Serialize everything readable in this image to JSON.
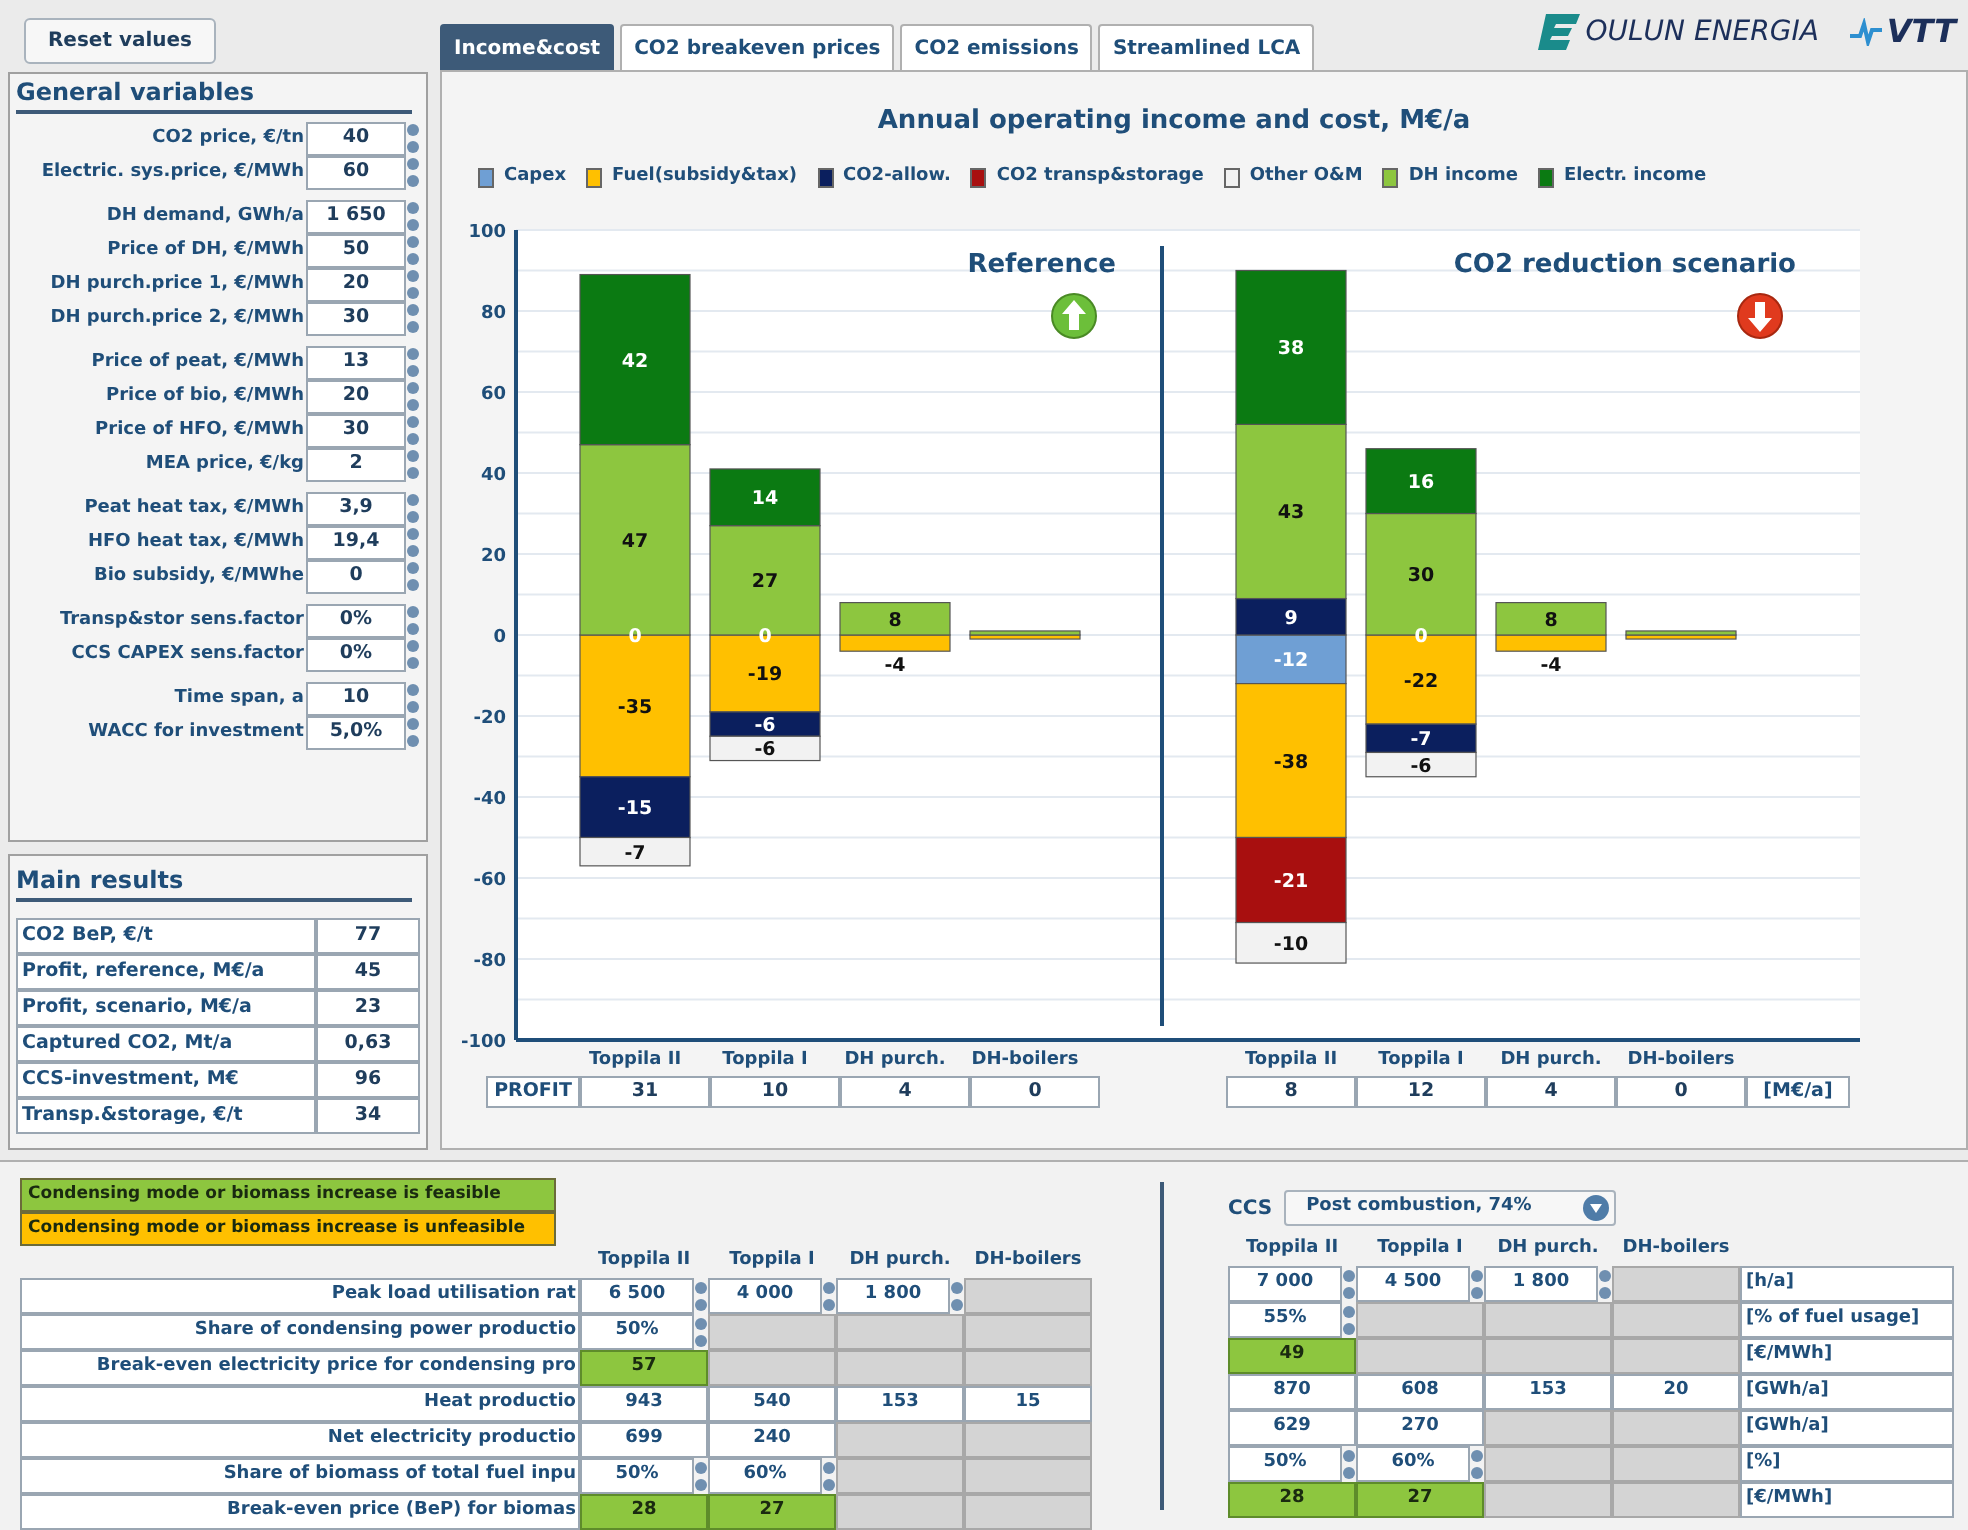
{
  "reset_button": "Reset values",
  "general_variables": {
    "title": "General variables",
    "groups": [
      [
        {
          "label": "CO2 price, €/tn",
          "value": "40"
        },
        {
          "label": "Electric. sys.price, €/MWh",
          "value": "60"
        }
      ],
      [
        {
          "label": "DH demand, GWh/a",
          "value": "1 650"
        },
        {
          "label": "Price of DH, €/MWh",
          "value": "50"
        },
        {
          "label": "DH purch.price 1, €/MWh",
          "value": "20"
        },
        {
          "label": "DH purch.price 2, €/MWh",
          "value": "30"
        }
      ],
      [
        {
          "label": "Price of peat, €/MWh",
          "value": "13"
        },
        {
          "label": "Price of bio, €/MWh",
          "value": "20"
        },
        {
          "label": "Price of HFO, €/MWh",
          "value": "30"
        },
        {
          "label": "MEA price, €/kg",
          "value": "2"
        }
      ],
      [
        {
          "label": "Peat heat tax, €/MWh",
          "value": "3,9"
        },
        {
          "label": "HFO heat tax, €/MWh",
          "value": "19,4"
        },
        {
          "label": "Bio subsidy, €/MWhe",
          "value": "0"
        }
      ],
      [
        {
          "label": "Transp&stor sens.factor",
          "value": "0%"
        },
        {
          "label": "CCS CAPEX sens.factor",
          "value": "0%"
        }
      ],
      [
        {
          "label": "Time span, a",
          "value": "10"
        },
        {
          "label": "WACC for investment",
          "value": "5,0%"
        }
      ]
    ]
  },
  "main_results": {
    "title": "Main results",
    "rows": [
      {
        "label": "CO2 BeP, €/t",
        "value": "77"
      },
      {
        "label": "Profit, reference, M€/a",
        "value": "45"
      },
      {
        "label": "Profit, scenario, M€/a",
        "value": "23"
      },
      {
        "label": "Captured CO2, Mt/a",
        "value": "0,63"
      },
      {
        "label": "CCS-investment, M€",
        "value": "96"
      },
      {
        "label": "Transp.&storage, €/t",
        "value": "34"
      }
    ]
  },
  "tabs": [
    {
      "label": "Income&cost",
      "selected": true
    },
    {
      "label": "CO2 breakeven prices",
      "selected": false
    },
    {
      "label": "CO2 emissions",
      "selected": false
    },
    {
      "label": "Streamlined LCA",
      "selected": false
    }
  ],
  "logos": [
    "OULUN ENERGIA",
    "VTT"
  ],
  "chart_title": "Annual operating income and cost, M€/a",
  "panels": [
    {
      "profit_increase": true,
      "profit_label": "PROFIT",
      "profits": [
        "31",
        "10",
        "4",
        "0"
      ],
      "chart_data": {
        "type": "bar",
        "stacked": true,
        "grid": true,
        "title": "Reference",
        "categories": [
          "Toppila II",
          "Toppila I",
          "DH purch.",
          "DH-boilers"
        ],
        "ylim": [
          -100,
          100
        ],
        "yticks": [
          -100,
          -80,
          -60,
          -40,
          -20,
          0,
          20,
          40,
          60,
          80,
          100
        ],
        "series": [
          {
            "name": "Capex",
            "color": "#6f9fd4",
            "values": [
              0,
              0,
              0,
              0
            ],
            "value_labels": [
              "0",
              "0",
              null,
              null
            ]
          },
          {
            "name": "Fuel(subsidy&tax)",
            "color": "#ffc000",
            "values": [
              -35,
              -19,
              -4,
              -1
            ],
            "value_labels": [
              "-35",
              "-19",
              "-4",
              null
            ]
          },
          {
            "name": "CO2-allow.",
            "color": "#0b1f5e",
            "values": [
              -15,
              -6,
              null,
              null
            ],
            "value_labels": [
              "-15",
              "-6",
              null,
              null
            ]
          },
          {
            "name": "CO2 transp&storage",
            "color": "#a80f0f",
            "values": [
              null,
              null,
              null,
              null
            ],
            "value_labels": [
              null,
              null,
              null,
              null
            ]
          },
          {
            "name": "Other O&M",
            "color": "#f2f2f2",
            "values": [
              -7,
              -6,
              null,
              null
            ],
            "value_labels": [
              "-7",
              "-6",
              null,
              null
            ]
          },
          {
            "name": "DH income",
            "color": "#8dc63f",
            "values": [
              47,
              27,
              8,
              1
            ],
            "value_labels": [
              "47",
              "27",
              "8",
              null
            ]
          },
          {
            "name": "Electr. income",
            "color": "#0b7a12",
            "values": [
              42,
              14,
              null,
              null
            ],
            "value_labels": [
              "42",
              "14",
              null,
              null
            ]
          }
        ]
      }
    },
    {
      "profit_increase": false,
      "profit_unit": "[M€/a]",
      "profits": [
        "8",
        "12",
        "4",
        "0"
      ],
      "chart_data": {
        "type": "bar",
        "stacked": true,
        "grid": true,
        "title": "CO2 reduction scenario",
        "categories": [
          "Toppila II",
          "Toppila I",
          "DH purch.",
          "DH-boilers"
        ],
        "ylim": [
          -100,
          100
        ],
        "series": [
          {
            "color": "#6f9fd4",
            "values": [
              -12,
              0,
              0,
              0
            ],
            "value_labels": [
              "-12",
              "0",
              null,
              null
            ]
          },
          {
            "color": "#ffc000",
            "values": [
              -38,
              -22,
              -4,
              -1
            ],
            "value_labels": [
              "-38",
              "-22",
              "-4",
              null
            ]
          },
          {
            "color": "#0b1f5e",
            "values": [
              9,
              -7,
              null,
              null
            ],
            "value_labels": [
              "9",
              "-7",
              null,
              null
            ]
          },
          {
            "color": "#a80f0f",
            "values": [
              -21,
              null,
              null,
              null
            ],
            "value_labels": [
              "-21",
              null,
              null,
              null
            ]
          },
          {
            "color": "#f2f2f2",
            "values": [
              -10,
              -6,
              null,
              null
            ],
            "value_labels": [
              "-10",
              "-6",
              null,
              null
            ]
          },
          {
            "color": "#8dc63f",
            "values": [
              43,
              30,
              8,
              1
            ],
            "value_labels": [
              "43",
              "30",
              "8",
              null
            ]
          },
          {
            "color": "#0b7a12",
            "values": [
              38,
              16,
              null,
              null
            ],
            "value_labels": [
              "38",
              "16",
              null,
              null
            ]
          }
        ]
      }
    }
  ],
  "feasibility_legend": [
    {
      "label": "Condensing mode or biomass increase is feasible",
      "color": "#8dc63f"
    },
    {
      "label": "Condensing mode or biomass increase is unfeasible",
      "color": "#ffc000"
    }
  ],
  "reference_table": {
    "columns": [
      "Toppila II",
      "Toppila I",
      "DH purch.",
      "DH-boilers"
    ],
    "rows": [
      {
        "label": "Peak load utilisation rat",
        "cells": [
          {
            "kind": "spin",
            "value": "6 500"
          },
          {
            "kind": "spin",
            "value": "4 000"
          },
          {
            "kind": "spin",
            "value": "1 800"
          },
          {
            "kind": "blank"
          }
        ]
      },
      {
        "label": "Share of condensing power productio",
        "cells": [
          {
            "kind": "spin",
            "value": "50%"
          },
          {
            "kind": "blank"
          },
          {
            "kind": "blank"
          },
          {
            "kind": "blank"
          }
        ]
      },
      {
        "label": "Break-even electricity price for condensing pro",
        "cells": [
          {
            "kind": "feasible",
            "value": "57"
          },
          {
            "kind": "blank"
          },
          {
            "kind": "blank"
          },
          {
            "kind": "blank"
          }
        ]
      },
      {
        "label": "Heat productio",
        "cells": [
          {
            "kind": "plain",
            "value": "943"
          },
          {
            "kind": "plain",
            "value": "540"
          },
          {
            "kind": "plain",
            "value": "153"
          },
          {
            "kind": "plain",
            "value": "15"
          }
        ]
      },
      {
        "label": "Net electricity productio",
        "cells": [
          {
            "kind": "plain",
            "value": "699"
          },
          {
            "kind": "plain",
            "value": "240"
          },
          {
            "kind": "blank"
          },
          {
            "kind": "blank"
          }
        ]
      },
      {
        "label": "Share of biomass of total fuel inpu",
        "cells": [
          {
            "kind": "spin",
            "value": "50%"
          },
          {
            "kind": "spin",
            "value": "60%"
          },
          {
            "kind": "blank"
          },
          {
            "kind": "blank"
          }
        ]
      },
      {
        "label": "Break-even price (BeP) for biomas",
        "cells": [
          {
            "kind": "feasible",
            "value": "28"
          },
          {
            "kind": "feasible",
            "value": "27"
          },
          {
            "kind": "blank"
          },
          {
            "kind": "blank"
          }
        ]
      }
    ]
  },
  "scenario_table": {
    "ccs_label": "CCS",
    "ccs_option": "Post combustion, 74%",
    "columns": [
      "Toppila II",
      "Toppila I",
      "DH purch.",
      "DH-boilers"
    ],
    "rows": [
      {
        "unit": "[h/a]",
        "cells": [
          {
            "kind": "spin",
            "value": "7 000"
          },
          {
            "kind": "spin",
            "value": "4 500"
          },
          {
            "kind": "spin",
            "value": "1 800"
          },
          {
            "kind": "blank"
          }
        ]
      },
      {
        "unit": "[% of fuel usage]",
        "cells": [
          {
            "kind": "spin",
            "value": "55%"
          },
          {
            "kind": "blank"
          },
          {
            "kind": "blank"
          },
          {
            "kind": "blank"
          }
        ]
      },
      {
        "unit": "[€/MWh]",
        "cells": [
          {
            "kind": "feasible",
            "value": "49"
          },
          {
            "kind": "blank"
          },
          {
            "kind": "blank"
          },
          {
            "kind": "blank"
          }
        ]
      },
      {
        "unit": "[GWh/a]",
        "cells": [
          {
            "kind": "plain",
            "value": "870"
          },
          {
            "kind": "plain",
            "value": "608"
          },
          {
            "kind": "plain",
            "value": "153"
          },
          {
            "kind": "plain",
            "value": "20"
          }
        ]
      },
      {
        "unit": "[GWh/a]",
        "cells": [
          {
            "kind": "plain",
            "value": "629"
          },
          {
            "kind": "plain",
            "value": "270"
          },
          {
            "kind": "blank"
          },
          {
            "kind": "blank"
          }
        ]
      },
      {
        "unit": "[%]",
        "cells": [
          {
            "kind": "spin",
            "value": "50%"
          },
          {
            "kind": "spin",
            "value": "60%"
          },
          {
            "kind": "blank"
          },
          {
            "kind": "blank"
          }
        ]
      },
      {
        "unit": "[€/MWh]",
        "cells": [
          {
            "kind": "feasible",
            "value": "28"
          },
          {
            "kind": "feasible",
            "value": "27"
          },
          {
            "kind": "blank"
          },
          {
            "kind": "blank"
          }
        ]
      }
    ]
  }
}
